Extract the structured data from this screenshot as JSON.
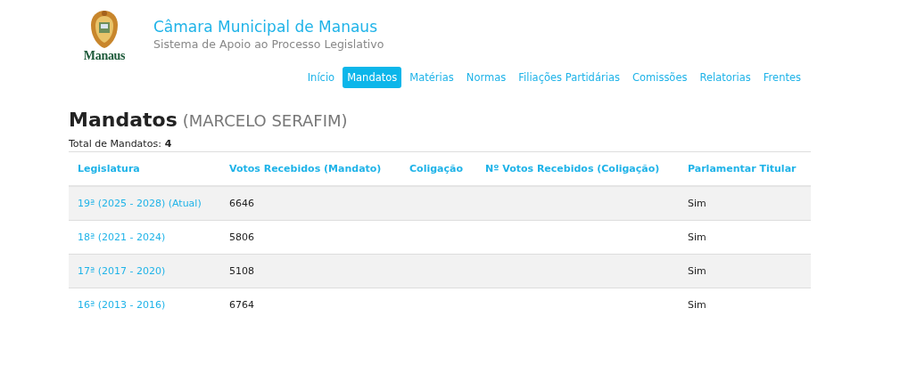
{
  "header": {
    "logo_text": "Manaus",
    "title": "Câmara Municipal de Manaus",
    "subtitle": "Sistema de Apoio ao Processo Legislativo"
  },
  "nav": [
    {
      "label": "Início",
      "selected": false
    },
    {
      "label": "Mandatos",
      "selected": true
    },
    {
      "label": "Matérias",
      "selected": false
    },
    {
      "label": "Normas",
      "selected": false
    },
    {
      "label": "Filiações Partidárias",
      "selected": false
    },
    {
      "label": "Comissões",
      "selected": false
    },
    {
      "label": "Relatorias",
      "selected": false
    },
    {
      "label": "Frentes",
      "selected": false
    }
  ],
  "page": {
    "title": "Mandatos",
    "subtitle": "(MARCELO SERAFIM)",
    "total_label": "Total de Mandatos:",
    "total": "4"
  },
  "table": {
    "columns": [
      "Legislatura",
      "Votos Recebidos (Mandato)",
      "Coligação",
      "Nº Votos Recebidos (Coligação)",
      "Parlamentar Titular"
    ],
    "rows": [
      {
        "legislatura": "19ª (2025 - 2028) (Atual)",
        "votos": "6646",
        "titular": "Sim"
      },
      {
        "legislatura": "18ª (2021 - 2024)",
        "votos": "5806",
        "titular": "Sim"
      },
      {
        "legislatura": "17ª (2017 - 2020)",
        "votos": "5108",
        "titular": "Sim"
      },
      {
        "legislatura": "16ª (2013 - 2016)",
        "votos": "6764",
        "titular": "Sim"
      }
    ]
  }
}
